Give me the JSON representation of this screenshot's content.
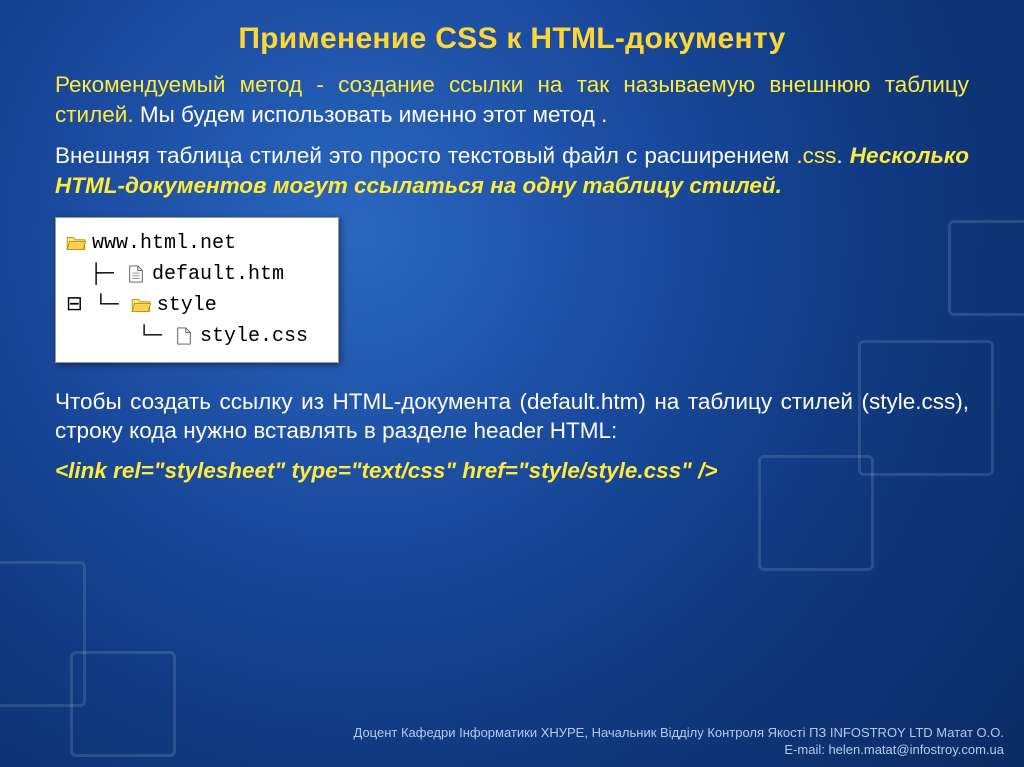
{
  "title": "Применение CSS к HTML-документу",
  "p1a": "Рекомендуемый метод - создание ссылки на так называемую внешнюю таблицу стилей.",
  "p1b": " Мы будем использовать именно этот метод .",
  "p2a": "Внешняя таблица стилей это просто текстовый файл с расширением ",
  "p2b": ".css",
  "p2c": ". ",
  "p2d": "Несколько HTML-документов могут ссылаться на одну таблицу стилей.",
  "tree": {
    "root": "www.html.net",
    "file1": "default.htm",
    "folder": "style",
    "file2": "style.css"
  },
  "p3": "Чтобы создать ссылку из HTML-документа (default.htm) на таблицу стилей (style.css), строку кода нужно вставлять в разделе header HTML:",
  "code": "<link rel=\"stylesheet\" type=\"text/css\" href=\"style/style.css\" />",
  "footer": {
    "line1": "Доцент Кафедри Інформатики ХНУРЕ, Начальник Відділу Контроля Якості ПЗ INFOSTROY LTD Матат О.О.",
    "line2": "E-mail: helen.matat@infostroy.com.ua"
  }
}
